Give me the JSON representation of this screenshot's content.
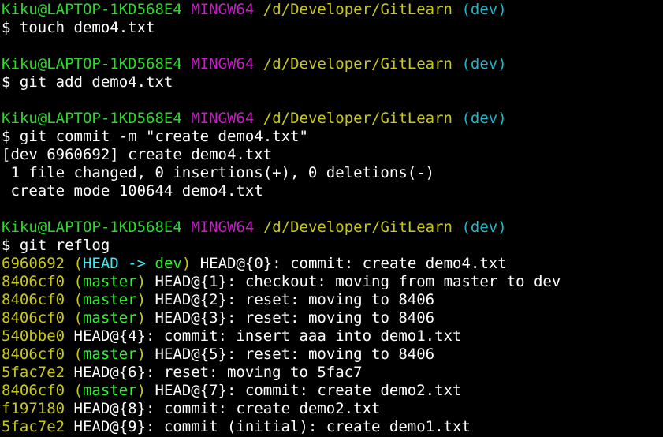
{
  "colors": {
    "background": "#000000",
    "default": "#ffffff",
    "green": "#2bd82b",
    "magenta": "#c41ec4",
    "yellow": "#c8c818",
    "cyan": "#22b4c8",
    "bright_cyan": "#38e8f0",
    "bright_green": "#30f030"
  },
  "terminal": {
    "lines": [
      [
        {
          "t": "Kiku@LAPTOP-1KD568E4",
          "c": "green"
        },
        {
          "t": " "
        },
        {
          "t": "MINGW64",
          "c": "magenta"
        },
        {
          "t": " "
        },
        {
          "t": "/d/Developer/GitLearn",
          "c": "yellow"
        },
        {
          "t": " "
        },
        {
          "t": "(dev)",
          "c": "cyan"
        }
      ],
      [
        {
          "t": "$ touch demo4.txt"
        }
      ],
      [],
      [
        {
          "t": "Kiku@LAPTOP-1KD568E4",
          "c": "green"
        },
        {
          "t": " "
        },
        {
          "t": "MINGW64",
          "c": "magenta"
        },
        {
          "t": " "
        },
        {
          "t": "/d/Developer/GitLearn",
          "c": "yellow"
        },
        {
          "t": " "
        },
        {
          "t": "(dev)",
          "c": "cyan"
        }
      ],
      [
        {
          "t": "$ git add demo4.txt"
        }
      ],
      [],
      [
        {
          "t": "Kiku@LAPTOP-1KD568E4",
          "c": "green"
        },
        {
          "t": " "
        },
        {
          "t": "MINGW64",
          "c": "magenta"
        },
        {
          "t": " "
        },
        {
          "t": "/d/Developer/GitLearn",
          "c": "yellow"
        },
        {
          "t": " "
        },
        {
          "t": "(dev)",
          "c": "cyan"
        }
      ],
      [
        {
          "t": "$ git commit -m \"create demo4.txt\""
        }
      ],
      [
        {
          "t": "[dev 6960692] create demo4.txt"
        }
      ],
      [
        {
          "t": " 1 file changed, 0 insertions(+), 0 deletions(-)"
        }
      ],
      [
        {
          "t": " create mode 100644 demo4.txt"
        }
      ],
      [],
      [
        {
          "t": "Kiku@LAPTOP-1KD568E4",
          "c": "green"
        },
        {
          "t": " "
        },
        {
          "t": "MINGW64",
          "c": "magenta"
        },
        {
          "t": " "
        },
        {
          "t": "/d/Developer/GitLearn",
          "c": "yellow"
        },
        {
          "t": " "
        },
        {
          "t": "(dev)",
          "c": "cyan"
        }
      ],
      [
        {
          "t": "$ git reflog"
        }
      ],
      [
        {
          "t": "6960692",
          "c": "yellow"
        },
        {
          "t": " "
        },
        {
          "t": "(",
          "c": "yellow"
        },
        {
          "t": "HEAD -> ",
          "c": "bright_cyan"
        },
        {
          "t": "dev",
          "c": "bright_green"
        },
        {
          "t": ")",
          "c": "yellow"
        },
        {
          "t": " HEAD@{0}: commit: create demo4.txt"
        }
      ],
      [
        {
          "t": "8406cf0",
          "c": "yellow"
        },
        {
          "t": " "
        },
        {
          "t": "(",
          "c": "yellow"
        },
        {
          "t": "master",
          "c": "bright_green"
        },
        {
          "t": ")",
          "c": "yellow"
        },
        {
          "t": " HEAD@{1}: checkout: moving from master to dev"
        }
      ],
      [
        {
          "t": "8406cf0",
          "c": "yellow"
        },
        {
          "t": " "
        },
        {
          "t": "(",
          "c": "yellow"
        },
        {
          "t": "master",
          "c": "bright_green"
        },
        {
          "t": ")",
          "c": "yellow"
        },
        {
          "t": " HEAD@{2}: reset: moving to 8406"
        }
      ],
      [
        {
          "t": "8406cf0",
          "c": "yellow"
        },
        {
          "t": " "
        },
        {
          "t": "(",
          "c": "yellow"
        },
        {
          "t": "master",
          "c": "bright_green"
        },
        {
          "t": ")",
          "c": "yellow"
        },
        {
          "t": " HEAD@{3}: reset: moving to 8406"
        }
      ],
      [
        {
          "t": "540bbe0",
          "c": "yellow"
        },
        {
          "t": " HEAD@{4}: commit: insert aaa into demo1.txt"
        }
      ],
      [
        {
          "t": "8406cf0",
          "c": "yellow"
        },
        {
          "t": " "
        },
        {
          "t": "(",
          "c": "yellow"
        },
        {
          "t": "master",
          "c": "bright_green"
        },
        {
          "t": ")",
          "c": "yellow"
        },
        {
          "t": " HEAD@{5}: reset: moving to 8406"
        }
      ],
      [
        {
          "t": "5fac7e2",
          "c": "yellow"
        },
        {
          "t": " HEAD@{6}: reset: moving to 5fac7"
        }
      ],
      [
        {
          "t": "8406cf0",
          "c": "yellow"
        },
        {
          "t": " "
        },
        {
          "t": "(",
          "c": "yellow"
        },
        {
          "t": "master",
          "c": "bright_green"
        },
        {
          "t": ")",
          "c": "yellow"
        },
        {
          "t": " HEAD@{7}: commit: create demo2.txt"
        }
      ],
      [
        {
          "t": "f197180",
          "c": "yellow"
        },
        {
          "t": " HEAD@{8}: commit: create demo2.txt"
        }
      ],
      [
        {
          "t": "5fac7e2",
          "c": "yellow"
        },
        {
          "t": " HEAD@{9}: commit (initial): create demo1.txt"
        }
      ]
    ]
  }
}
